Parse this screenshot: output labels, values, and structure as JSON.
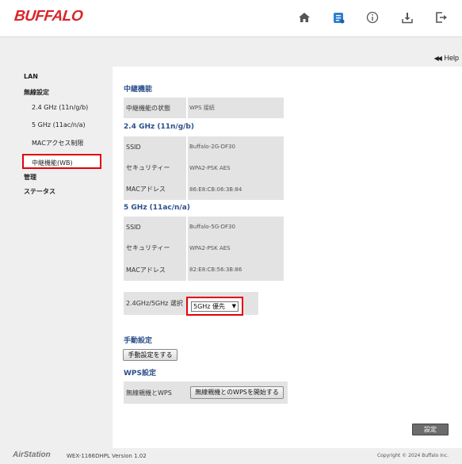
{
  "brand": {
    "logo": "BUFFALO",
    "accent": "#d8262b"
  },
  "header_icons": [
    "home-icon",
    "network-setup-icon",
    "info-icon",
    "download-icon",
    "logout-icon"
  ],
  "help": {
    "label": "Help"
  },
  "sidebar": {
    "lan": "LAN",
    "wireless": "無線設定",
    "wireless_items": [
      "2.4 GHz (11n/g/b)",
      "5 GHz (11ac/n/a)",
      "MACアクセス制限",
      "中継機能(WB)"
    ],
    "admin": "管理",
    "status": "ステータス",
    "active_index": 3
  },
  "main": {
    "repeater_title": "中継機能",
    "repeater_status_label": "中継機能の状態",
    "repeater_status_value": "WPS 接続",
    "band24_title": "2.4 GHz (11n/g/b)",
    "band24": {
      "ssid_label": "SSID",
      "ssid": "Buffalo-2G-DF30",
      "security_label": "セキュリティー",
      "security": "WPA2-PSK AES",
      "mac_label": "MACアドレス",
      "mac": "86:E8:CB:06:3B:84"
    },
    "band5_title": "5 GHz (11ac/n/a)",
    "band5": {
      "ssid_label": "SSID",
      "ssid": "Buffalo-5G-DF30",
      "security_label": "セキュリティー",
      "security": "WPA2-PSK AES",
      "mac_label": "MACアドレス",
      "mac": "82:E8:CB:56:3B:86"
    },
    "band_select_label": "2.4GHz/5GHz 選択",
    "band_select_value": "5GHz 優先",
    "manual_title": "手動設定",
    "manual_button": "手動設定をする",
    "wps_title": "WPS設定",
    "wps_label": "無線親機とWPS",
    "wps_button": "無線親機とのWPSを開始する",
    "save_button": "設定"
  },
  "footer": {
    "logo": "AirStation",
    "model": "WEX-1166DHPL Version 1.02",
    "copyright": "Copyright © 2024 Buffalo Inc."
  }
}
